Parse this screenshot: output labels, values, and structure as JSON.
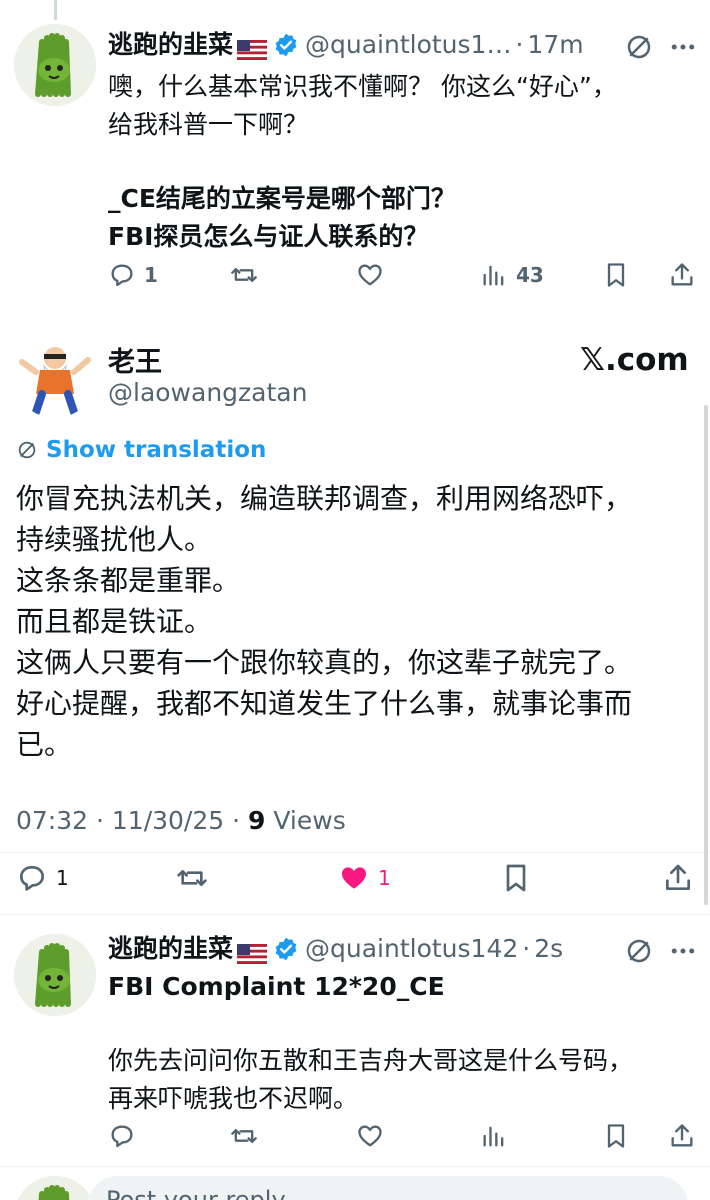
{
  "reply_top": {
    "display_name": "逃跑的韭菜",
    "handle": "@quaintlotus1…",
    "separator": "·",
    "time": "17m",
    "text_line1": "噢，什么基本常识我不懂啊？ 你这么“好心”，\n给我科普一下啊？",
    "text_line2": "_CE结尾的立案号是哪个部门？\nFBI探员怎么与证人联系的？",
    "actions": {
      "replies": "1",
      "retweets": "",
      "likes": "",
      "views": "43"
    }
  },
  "main_tweet": {
    "display_name": "老王",
    "handle": "@laowangzatan",
    "site_label": "𝕏.com",
    "show_translation": "Show translation",
    "body": "你冒充执法机关，编造联邦调查，利用网络恐吓，\n持续骚扰他人。\n这条条都是重罪。\n而且都是铁证。\n这俩人只要有一个跟你较真的，你这辈子就完了。\n好心提醒，我都不知道发生了什么事，就事论事而\n已。",
    "timestamp": "07:32 · 11/30/25 · ",
    "views_count": "9",
    "views_label": " Views",
    "actions": {
      "replies": "1",
      "retweets": "",
      "likes": "1"
    },
    "like_color": "#f91880"
  },
  "reply_bottom": {
    "display_name": "逃跑的韭菜",
    "handle": "@quaintlotus142",
    "separator": "·",
    "time": "2s",
    "text_bold": "FBI Complaint 12*20_CE",
    "text_body": "你先去问问你五散和王吉舟大哥这是什么号码，\n再来吓唬我也不迟啊。"
  },
  "reply_input": {
    "placeholder": "Post your reply"
  },
  "colors": {
    "accent": "#1d9bf0",
    "secondary_text": "#536471",
    "verified": "#1d9bf0"
  },
  "icons": [
    "flag-us-icon",
    "verified-badge-icon",
    "translate-icon",
    "more-icon",
    "reply-icon",
    "retweet-icon",
    "like-icon",
    "views-icon",
    "bookmark-icon",
    "share-icon"
  ]
}
